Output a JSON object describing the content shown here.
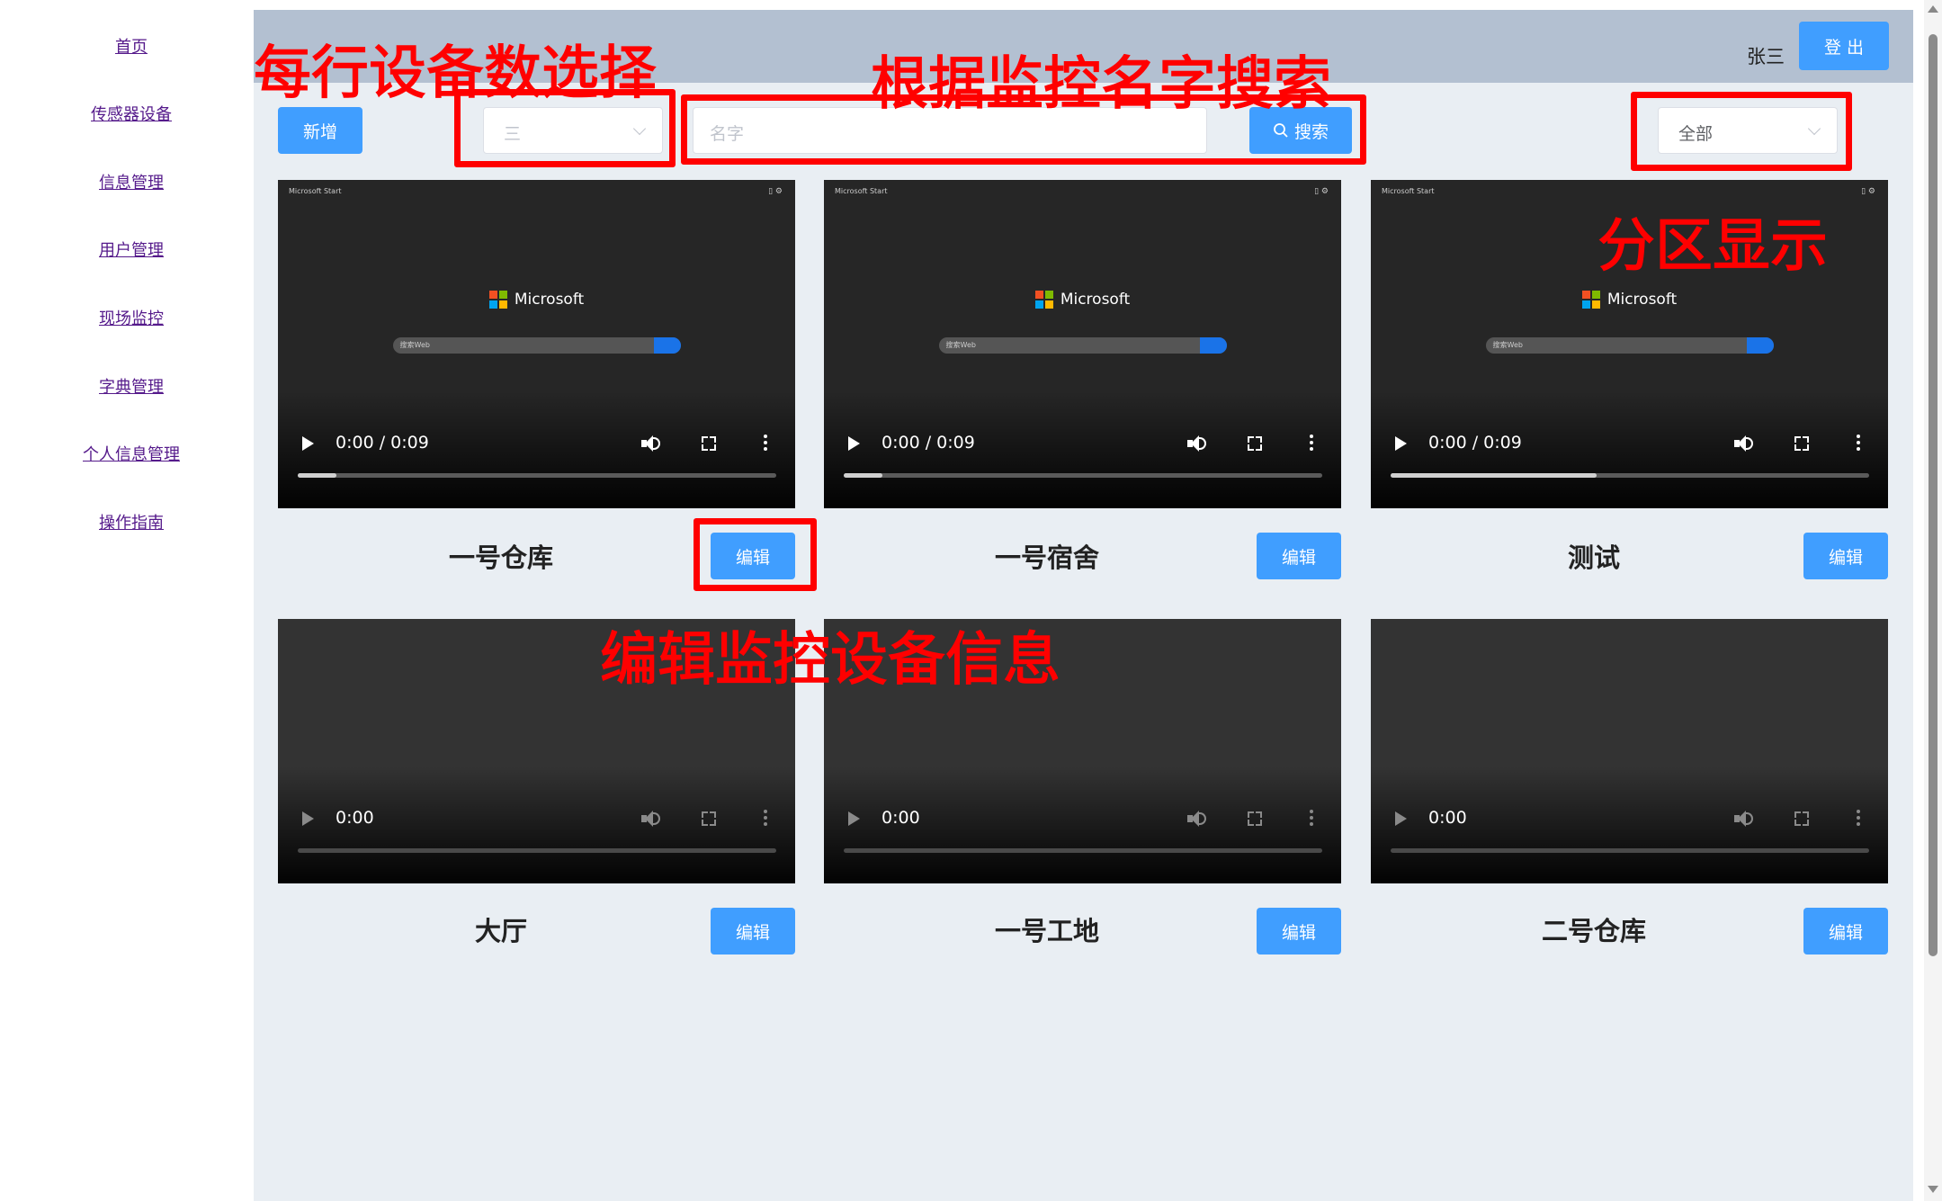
{
  "sidebar": {
    "items": [
      "首页",
      "传感器设备",
      "信息管理",
      "用户管理",
      "现场监控",
      "字典管理",
      "个人信息管理",
      "操作指南"
    ]
  },
  "header": {
    "username": "张三",
    "logout_label": "登 出"
  },
  "toolbar": {
    "add_label": "新增",
    "per_row_value": "三",
    "search_placeholder": "名字",
    "search_label": "搜索",
    "zone_value": "全部"
  },
  "cards": [
    {
      "name": "一号仓库",
      "edit_label": "编辑",
      "time": "0:00 / 0:09",
      "progress": 0.08
    },
    {
      "name": "一号宿舍",
      "edit_label": "编辑",
      "time": "0:00 / 0:09",
      "progress": 0.08
    },
    {
      "name": "测试",
      "edit_label": "编辑",
      "time": "0:00 / 0:09",
      "progress": 0.43
    },
    {
      "name": "大厅",
      "edit_label": "编辑",
      "time": "0:00",
      "progress": 0
    },
    {
      "name": "一号工地",
      "edit_label": "编辑",
      "time": "0:00",
      "progress": 0
    },
    {
      "name": "二号仓库",
      "edit_label": "编辑",
      "time": "0:00",
      "progress": 0
    }
  ],
  "preview": {
    "brand": "Microsoft",
    "bar_title": "Microsoft Start",
    "search_hint": "搜索Web"
  },
  "annotations": {
    "per_row": "每行设备数选择",
    "search": "根据监控名字搜索",
    "zone": "分区显示",
    "edit": "编辑监控设备信息"
  },
  "colors": {
    "accent": "#409eff",
    "header_bg": "#b3c0d1",
    "main_bg": "#e9eef3",
    "annotation": "#ff0000"
  }
}
